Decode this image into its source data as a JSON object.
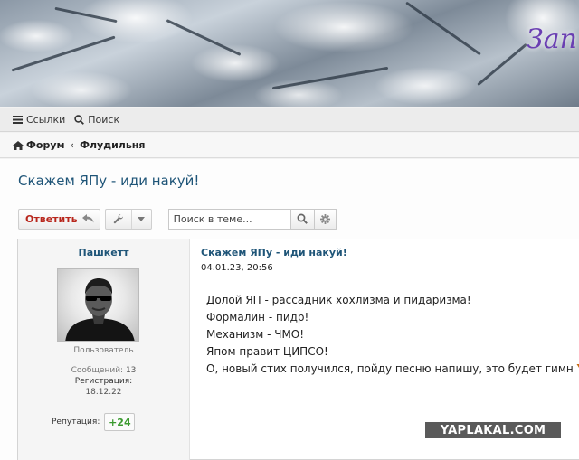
{
  "banner": {
    "title_fragment": "Зап"
  },
  "topnav": {
    "links_label": "Ссылки",
    "search_label": "Поиск"
  },
  "breadcrumb": {
    "forum": "Форум",
    "separator": "‹",
    "section": "Флудильня"
  },
  "thread": {
    "title": "Скажем ЯПу - иди накуй!"
  },
  "toolbar": {
    "reply_label": "Ответить",
    "search_placeholder": "Поиск в теме..."
  },
  "post": {
    "author": {
      "name": "Пашкетт",
      "title": "Пользователь",
      "messages_label": "Сообщений:",
      "messages_value": "13",
      "registered_label": "Регистрация:",
      "registered_value": "18.12.22",
      "reputation_label": "Репутация:",
      "reputation_value": "+24"
    },
    "title": "Скажем ЯПу - иди накуй!",
    "date": "04.01.23, 20:56",
    "lines": [
      "Долой ЯП - рассадник хохлизма и пидаризма!",
      "Формалин - пидр!",
      "Механизм - ЧМО!",
      "Япом правит ЦИПСО!"
    ],
    "last_line_text": "О, новый стих получился, пойду песню напишу, это будет гимн ",
    "last_line_highlight": "Y"
  },
  "watermark": "YAPLAKAL.COM",
  "colors": {
    "link_blue": "#1f5578",
    "reply_red": "#b8261c",
    "reputation_green": "#3a9a2e",
    "banner_purple": "#6a3fb2"
  }
}
